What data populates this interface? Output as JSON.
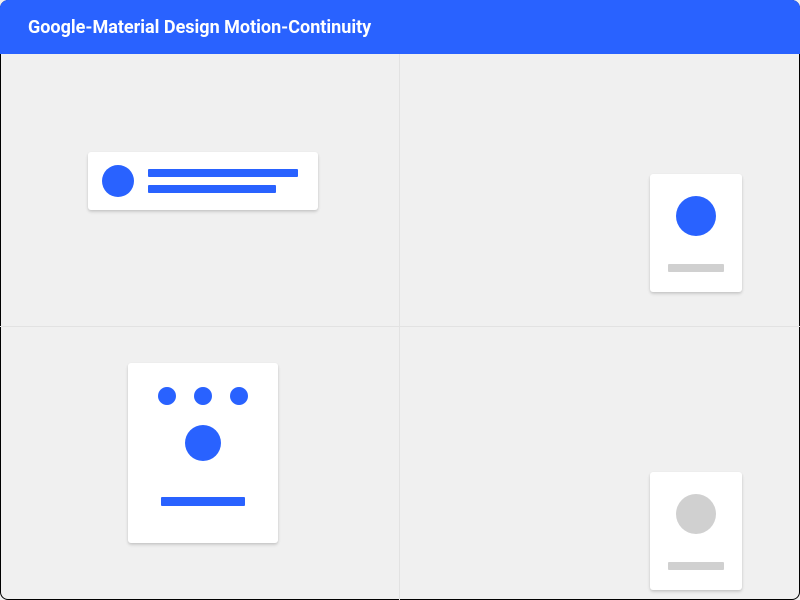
{
  "header": {
    "title": "Google-Material Design Motion-Continuity"
  },
  "colors": {
    "primary": "#2962ff",
    "muted": "#d0d0d0",
    "surface": "#ffffff",
    "background": "#f0f0f0"
  },
  "quadrants": [
    {
      "id": "list-item-card",
      "avatar_color": "primary",
      "lines": 2,
      "line_color": "primary"
    },
    {
      "id": "profile-tile-active",
      "avatar_color": "primary",
      "line_color": "muted"
    },
    {
      "id": "dots-card",
      "dot_count": 3,
      "dot_color": "primary",
      "big_dot_color": "primary",
      "bar_color": "primary"
    },
    {
      "id": "profile-tile-inactive",
      "avatar_color": "muted",
      "line_color": "muted"
    }
  ]
}
